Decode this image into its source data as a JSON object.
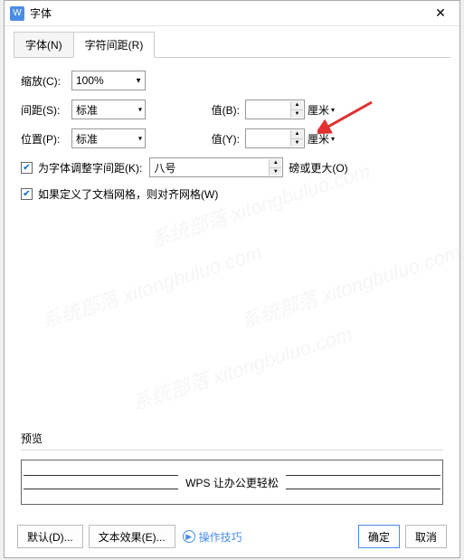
{
  "title": "字体",
  "app_icon": "W",
  "tabs": {
    "font": "字体(N)",
    "spacing": "字符间距(R)"
  },
  "scale": {
    "label": "缩放(C):",
    "value": "100%"
  },
  "spacing": {
    "label": "间距(S):",
    "value": "标准",
    "val_label": "值(B):",
    "val": "",
    "unit": "厘米"
  },
  "position": {
    "label": "位置(P):",
    "value": "标准",
    "val_label": "值(Y):",
    "val": "",
    "unit": "厘米"
  },
  "kerning": {
    "check_label": "为字体调整字间距(K):",
    "value": "八号",
    "unit": "磅或更大(O)"
  },
  "grid": {
    "check_label": "如果定义了文档网格，则对齐网格(W)"
  },
  "preview": {
    "label": "预览",
    "text": "WPS 让办公更轻松"
  },
  "footer": {
    "default": "默认(D)...",
    "effects": "文本效果(E)...",
    "tips": "操作技巧",
    "ok": "确定",
    "cancel": "取消"
  }
}
